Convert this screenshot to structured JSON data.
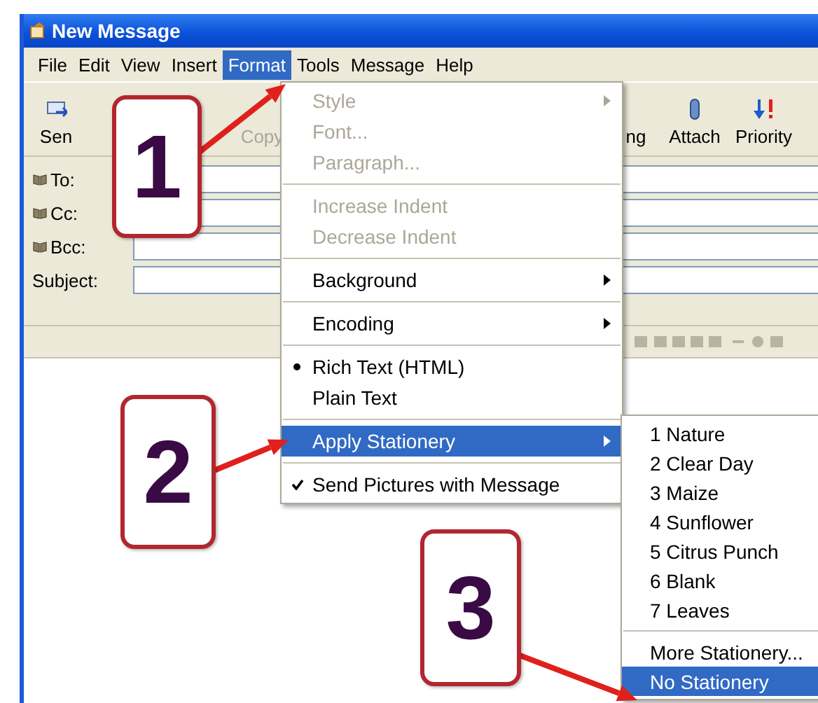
{
  "window": {
    "title": "New Message"
  },
  "menu_bar": [
    {
      "label": "File",
      "selected": false
    },
    {
      "label": "Edit",
      "selected": false
    },
    {
      "label": "View",
      "selected": false
    },
    {
      "label": "Insert",
      "selected": false
    },
    {
      "label": "Format",
      "selected": true
    },
    {
      "label": "Tools",
      "selected": false
    },
    {
      "label": "Message",
      "selected": false
    },
    {
      "label": "Help",
      "selected": false
    }
  ],
  "toolbar": [
    {
      "label": "Sen",
      "disabled": false
    },
    {
      "label": "Copy",
      "disabled": true
    },
    {
      "label": "ng",
      "disabled": false
    },
    {
      "label": "Attach",
      "disabled": false
    },
    {
      "label": "Priority",
      "disabled": false
    }
  ],
  "address_fields": [
    {
      "label": "To:",
      "book": true
    },
    {
      "label": "Cc:",
      "book": true
    },
    {
      "label": "Bcc:",
      "book": true
    },
    {
      "label": "Subject:",
      "book": false
    }
  ],
  "format_menu": [
    {
      "kind": "item",
      "label": "Style",
      "disabled": true,
      "submenu": true,
      "selected": false
    },
    {
      "kind": "item",
      "label": "Font...",
      "disabled": true,
      "submenu": false,
      "selected": false
    },
    {
      "kind": "item",
      "label": "Paragraph...",
      "disabled": true,
      "submenu": false,
      "selected": false
    },
    {
      "kind": "separator"
    },
    {
      "kind": "item",
      "label": "Increase Indent",
      "disabled": true,
      "submenu": false,
      "selected": false
    },
    {
      "kind": "item",
      "label": "Decrease Indent",
      "disabled": true,
      "submenu": false,
      "selected": false
    },
    {
      "kind": "separator"
    },
    {
      "kind": "item",
      "label": "Background",
      "disabled": false,
      "submenu": true,
      "selected": false
    },
    {
      "kind": "separator"
    },
    {
      "kind": "item",
      "label": "Encoding",
      "disabled": false,
      "submenu": true,
      "selected": false
    },
    {
      "kind": "separator"
    },
    {
      "kind": "radio",
      "label": "Rich Text (HTML)",
      "checked": true,
      "selected": false
    },
    {
      "kind": "radio",
      "label": "Plain Text",
      "checked": false,
      "selected": false
    },
    {
      "kind": "separator"
    },
    {
      "kind": "item",
      "label": "Apply Stationery",
      "disabled": false,
      "submenu": true,
      "selected": true
    },
    {
      "kind": "separator"
    },
    {
      "kind": "check",
      "label": "Send Pictures with Message",
      "checked": true,
      "selected": false
    }
  ],
  "stationery_menu": [
    {
      "kind": "item",
      "label": "1 Nature",
      "selected": false
    },
    {
      "kind": "item",
      "label": "2 Clear Day",
      "selected": false
    },
    {
      "kind": "item",
      "label": "3 Maize",
      "selected": false
    },
    {
      "kind": "item",
      "label": "4 Sunflower",
      "selected": false
    },
    {
      "kind": "item",
      "label": "5 Citrus Punch",
      "selected": false
    },
    {
      "kind": "item",
      "label": "6 Blank",
      "selected": false
    },
    {
      "kind": "item",
      "label": "7 Leaves",
      "selected": false
    },
    {
      "kind": "separator"
    },
    {
      "kind": "item",
      "label": "More Stationery...",
      "selected": false
    },
    {
      "kind": "item",
      "label": "No Stationery",
      "selected": true
    }
  ],
  "callouts": [
    {
      "label": "1"
    },
    {
      "label": "2"
    },
    {
      "label": "3"
    }
  ]
}
